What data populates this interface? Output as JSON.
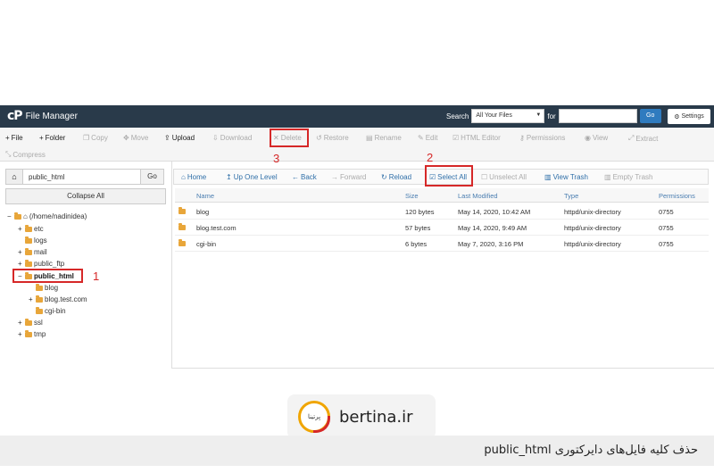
{
  "app": {
    "logo": "cP",
    "title": "File Manager"
  },
  "search": {
    "label": "Search",
    "scope": "All Your Files",
    "for_label": "for",
    "go": "Go",
    "settings": "Settings"
  },
  "toolbar": {
    "file": "File",
    "folder": "Folder",
    "copy": "Copy",
    "move": "Move",
    "upload": "Upload",
    "download": "Download",
    "delete": "Delete",
    "restore": "Restore",
    "rename": "Rename",
    "edit": "Edit",
    "html_editor": "HTML Editor",
    "permissions": "Permissions",
    "view": "View",
    "extract": "Extract",
    "compress": "Compress"
  },
  "left": {
    "path": "public_html",
    "go": "Go",
    "collapse": "Collapse All",
    "tree": {
      "root": "(/home/nadinidea)",
      "etc": "etc",
      "logs": "logs",
      "mail": "mail",
      "public_ftp": "public_ftp",
      "public_html": "public_html",
      "blog": "blog",
      "blog_test": "blog.test.com",
      "cgi_bin": "cgi-bin",
      "ssl": "ssl",
      "tmp": "tmp"
    }
  },
  "nav": {
    "home": "Home",
    "up": "Up One Level",
    "back": "Back",
    "forward": "Forward",
    "reload": "Reload",
    "select_all": "Select All",
    "unselect_all": "Unselect All",
    "view_trash": "View Trash",
    "empty_trash": "Empty Trash"
  },
  "table": {
    "headers": {
      "name": "Name",
      "size": "Size",
      "modified": "Last Modified",
      "type": "Type",
      "perms": "Permissions"
    },
    "rows": [
      {
        "name": "blog",
        "size": "120 bytes",
        "modified": "May 14, 2020, 10:42 AM",
        "type": "httpd/unix-directory",
        "perms": "0755"
      },
      {
        "name": "blog.test.com",
        "size": "57 bytes",
        "modified": "May 14, 2020, 9:49 AM",
        "type": "httpd/unix-directory",
        "perms": "0755"
      },
      {
        "name": "cgi-bin",
        "size": "6 bytes",
        "modified": "May 7, 2020, 3:16 PM",
        "type": "httpd/unix-directory",
        "perms": "0755"
      }
    ]
  },
  "annotations": {
    "n1": "1",
    "n2": "2",
    "n3": "3"
  },
  "footer": {
    "brand": "bertina.ir",
    "logo_text": "بِرتینا",
    "caption": "حذف کلیه فایل‌های دایرکتوری public_html"
  }
}
